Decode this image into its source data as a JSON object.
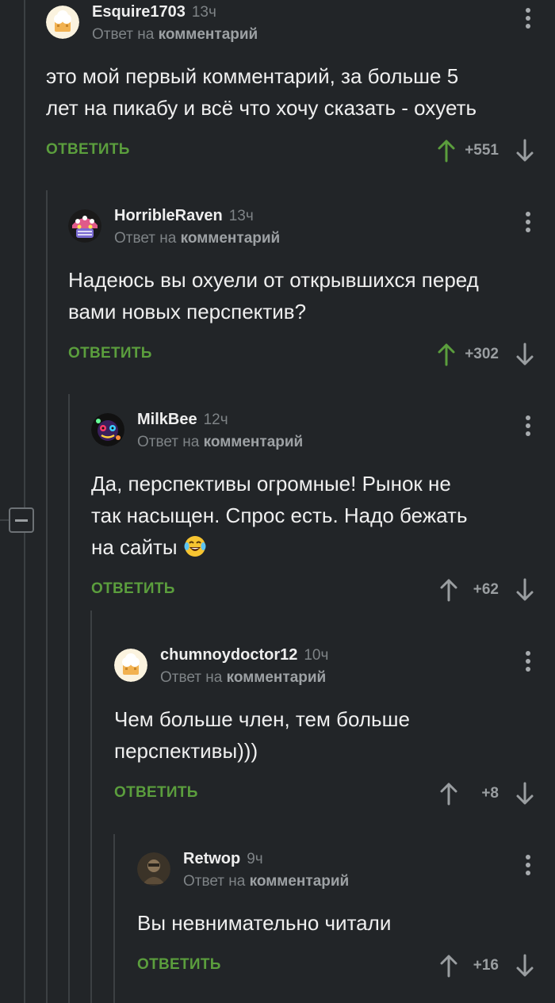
{
  "reply_to_prefix": "Ответ на",
  "reply_to_target": "комментарий",
  "reply_label": "ОТВЕТИТЬ",
  "colors": {
    "background": "#222528",
    "reply_green": "#5b9e3d",
    "vote_up_active": "#5b9e3d",
    "text": "#efefef",
    "muted": "#7e8386"
  },
  "comments": [
    {
      "username": "Esquire1703",
      "time": "13ч",
      "avatar": "chef-hat-avatar",
      "text": "это мой первый комментарий, за больше 5\nлет на пикабу и всё что хочу сказать - охуеть",
      "score": "+551",
      "upvoted": true
    },
    {
      "username": "HorribleRaven",
      "time": "13ч",
      "avatar": "pink-monster-avatar",
      "text": "Надеюсь вы охуели от открывшихся перед\nвами новых перспектив?",
      "score": "+302",
      "upvoted": true
    },
    {
      "username": "MilkBee",
      "time": "12ч",
      "avatar": "colorful-mask-avatar",
      "text_lines": [
        "Да, перспективы огромные! Рынок не",
        "так насыщен. Спрос есть. Надо бежать",
        "на сайты"
      ],
      "emoji": "laughing-tears-emoji",
      "score": "+62",
      "upvoted": false
    },
    {
      "username": "chumnoydoctor12",
      "time": "10ч",
      "avatar": "chef-hat-avatar",
      "text": "Чем больше член, тем больше\nперспективы)))",
      "score": "+8",
      "upvoted": false
    },
    {
      "username": "Retwop",
      "time": "9ч",
      "avatar": "dark-photo-avatar",
      "text": "Вы невнимательно читали",
      "score": "+16",
      "upvoted": false
    }
  ]
}
